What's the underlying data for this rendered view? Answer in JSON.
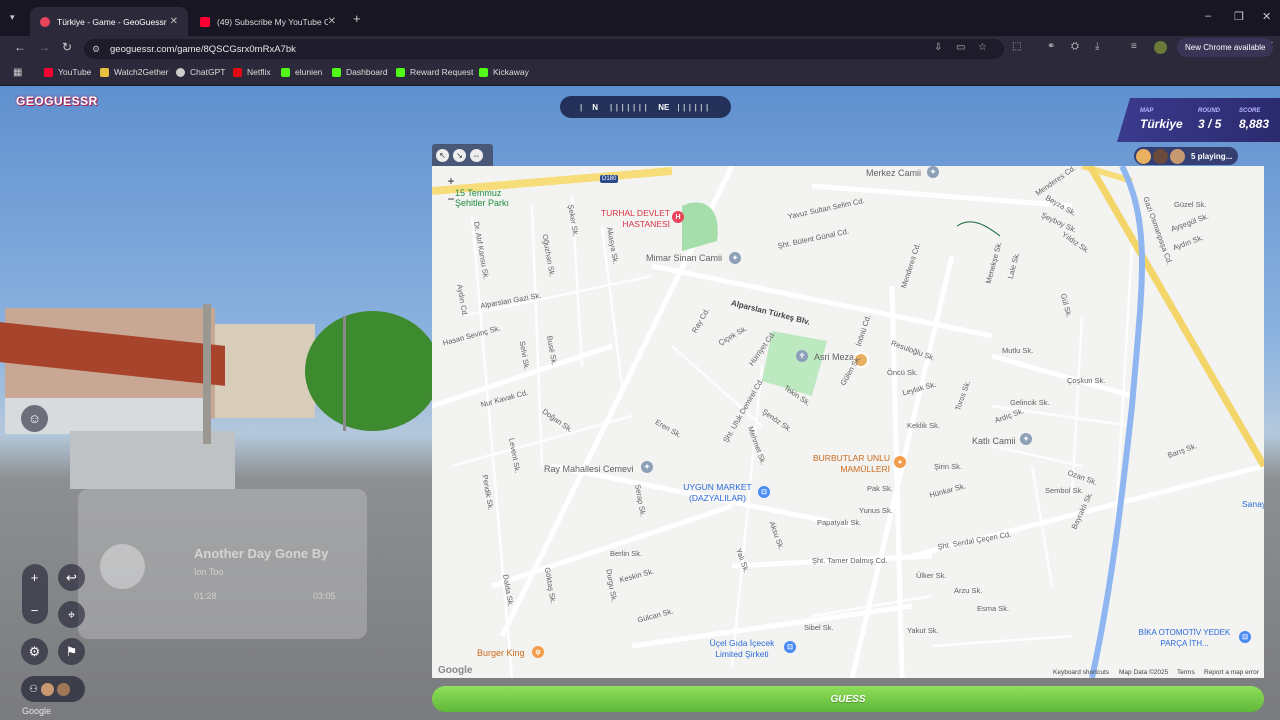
{
  "browser": {
    "tabs": [
      {
        "title": "Türkiye - Game - GeoGuessr",
        "active": true,
        "color": "#e8445a"
      },
      {
        "title": "(49) Subscribe My YouTube Cha",
        "active": false,
        "color": "#ff0033"
      }
    ],
    "url": "geoguessr.com/game/8QSCGsrx0mRxA7bk",
    "new_chrome": "New Chrome available",
    "bookmarks": [
      {
        "label": "YouTube",
        "color": "#ff0033"
      },
      {
        "label": "Watch2Gether",
        "color": "#e8c040"
      },
      {
        "label": "ChatGPT",
        "color": "#cccccc"
      },
      {
        "label": "Netflix",
        "color": "#e50914"
      },
      {
        "label": "elunien",
        "color": "#53fc18"
      },
      {
        "label": "Dashboard",
        "color": "#53fc18"
      },
      {
        "label": "Reward Request",
        "color": "#53fc18"
      },
      {
        "label": "Kickaway",
        "color": "#53fc18"
      }
    ]
  },
  "game": {
    "logo": "GEOGUESSR",
    "compass": {
      "n": "N",
      "ne": "NE"
    },
    "status": {
      "map_label": "MAP",
      "map": "Türkiye",
      "round_label": "ROUND",
      "round": "3 / 5",
      "score_label": "SCORE",
      "score": "8,883"
    },
    "playing": "5 playing...",
    "guess_button": "GUESS",
    "player": {
      "title": "Another Day Gone By",
      "artist": "Ion Too",
      "elapsed": "01:28",
      "duration": "03:05"
    },
    "google": "Google"
  },
  "map": {
    "streets": [
      "Merkez Camii",
      "Menderes Cd.",
      "Gazi Osmanpaşa Cd.",
      "Yavuz Sultan Selim Cd.",
      "Şht. Bülent Günal Cd.",
      "Alparslan Türkeş Blv.",
      "Menderes Cd.",
      "İnönü Cd.",
      "Resuloğlu Sk.",
      "Hürriyet Cd.",
      "Çiçek Sk.",
      "Ray Cd.",
      "Şht. Ufuk Demirel Cd.",
      "Gülen Sk.",
      "Tekin Sk.",
      "Öncü Sk.",
      "Leylak Sk.",
      "Keklik Sk.",
      "Gelincik Sk.",
      "Ardıç Sk.",
      "Toros Sk.",
      "Çoşkun Sk.",
      "Mutlu Sk.",
      "Şirin Sk.",
      "Hünkar Sk.",
      "Sembol Sk.",
      "Pak Sk.",
      "Yunus Sk.",
      "Papatyalı Sk.",
      "Şht. Serdal Çeçen Cd.",
      "Şht. Tamer Dalmış Cd.",
      "Ülker Sk.",
      "Arzu Sk.",
      "Esma Sk.",
      "Yakut Sk.",
      "Keskin Sk.",
      "Gülcan Sk.",
      "Nur Kavak Cd.",
      "Hasan Sevinç Sk.",
      "Alparslan Gazi Sk.",
      "Doğan Sk.",
      "Eren Sk.",
      "Şeker Sk.",
      "Akasya Sk.",
      "Oğuzhan Sk.",
      "Busé Sk.",
      "Selvi Sk.",
      "Aydın Cd.",
      "Dr. Atıf Kansu Sk.",
      "Levent Sk.",
      "Pendik Sk.",
      "Serap Sk.",
      "Berlin Sk.",
      "Dalda Sk.",
      "Göktaş Sk.",
      "Durgu Sk.",
      "Yalı Sk.",
      "Aksu Sk.",
      "Mehmet Sk.",
      "Şenöz Sk.",
      "Sibel Sk.",
      "Bayraklı Sk.",
      "Menekşe Sk.",
      "Lale Sk.",
      "Yıldız Sk.",
      "Şeyboy Sk.",
      "Beyza Sk.",
      "Güzel Sk.",
      "Ayşegül Sk.",
      "Aydın Sk.",
      "Barış Sk.",
      "Ozan Sk.",
      "Gül Sk."
    ],
    "places": {
      "park": "15 Temmuz Şehitler Parkı",
      "hospital": "TURHAL DEVLET HASTANESİ",
      "mosque1": "Mimar Sinan Camii",
      "cemetery": "Asri Mezarlık",
      "bakery": "BURBUTLAR UNLU MAMÜLLERİ",
      "katli": "Katlı Camii",
      "market": "UYGUN MARKET (DAZYALILAR)",
      "cemevi": "Ray Mahallesi Cemevi",
      "burger": "Burger King",
      "ucel": "Üçel Gıda İçecek Limited Şirketi",
      "bika": "BİKA OTOMOTİV YEDEK PARÇA İTH...",
      "sanayi": "Sanay",
      "road": "D180"
    },
    "attrib": {
      "keys": "Keyboard shortcuts",
      "data": "Map Data ©2025",
      "terms": "Terms",
      "report": "Report a map error",
      "google": "Google"
    },
    "zoom_in": "+",
    "zoom_out": "−"
  }
}
